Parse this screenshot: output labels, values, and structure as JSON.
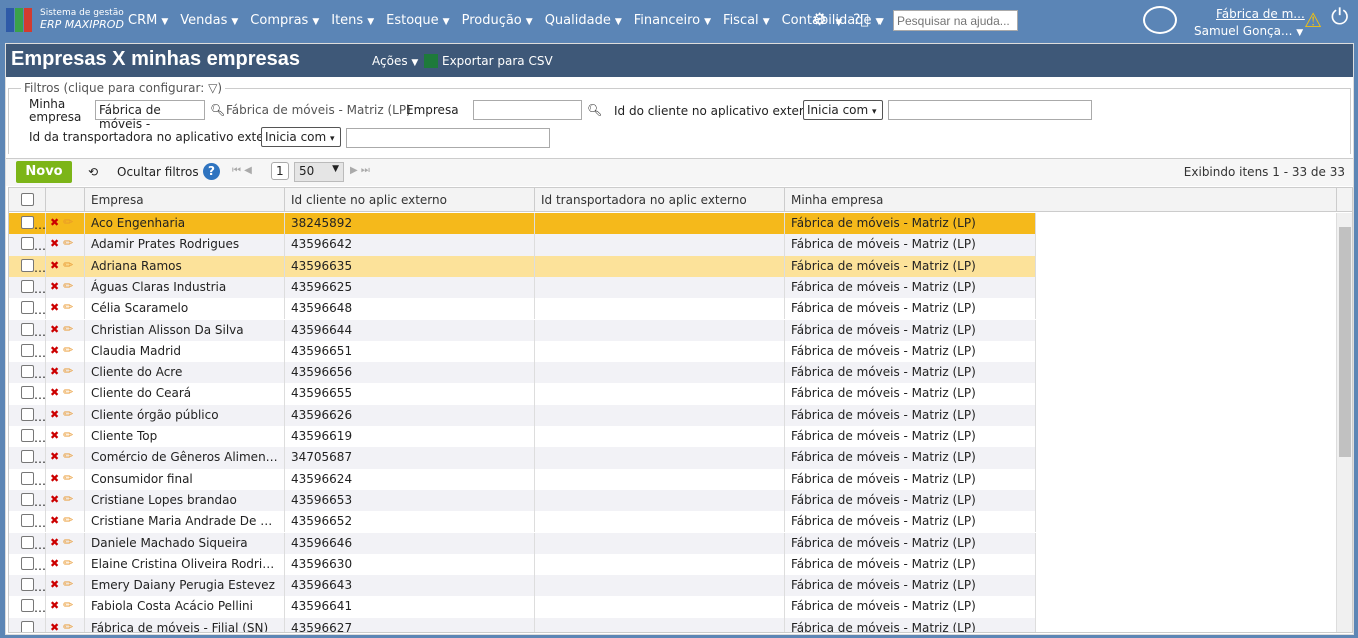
{
  "nav": {
    "brand_top": "Sistema de gestão",
    "brand_bottom": "ERP MAXIPROD",
    "menu": [
      "CRM",
      "Vendas",
      "Compras",
      "Itens",
      "Estoque",
      "Produção",
      "Qualidade",
      "Financeiro",
      "Fiscal",
      "Contabilidade"
    ],
    "help_placeholder": "Pesquisar na ajuda...",
    "company": "Fábrica de m...",
    "user": "Samuel Gonça..."
  },
  "page": {
    "title": "Empresas X minhas empresas",
    "actions": "Ações",
    "export": "Exportar para CSV"
  },
  "filters": {
    "legend": "Filtros (clique para configurar:",
    "minha_empresa_label": "Minha empresa",
    "minha_empresa_value": "Fábrica de móveis -",
    "minha_empresa_desc": "Fábrica de móveis - Matriz (LP)",
    "empresa_label": "Empresa",
    "id_cliente_label": "Id do cliente no aplicativo externo",
    "id_cliente_op": "Inicia com",
    "id_transp_label": "Id da transportadora no aplicativo externo",
    "id_transp_op": "Inicia com"
  },
  "toolbar": {
    "new": "Novo",
    "hide_filters": "Ocultar filtros",
    "page": "1",
    "page_size": "50",
    "showing": "Exibindo itens 1 - 33 de 33"
  },
  "columns": [
    "Empresa",
    "Id cliente no aplic externo",
    "Id transportadora no aplic externo",
    "Minha empresa"
  ],
  "colors": {
    "selected": "#f5b91b",
    "hover": "#fce29a"
  },
  "rows": [
    [
      "Aco Engenharia",
      "38245892",
      "",
      "Fábrica de móveis - Matriz (LP)"
    ],
    [
      "Adamir Prates Rodrigues",
      "43596642",
      "",
      "Fábrica de móveis - Matriz (LP)"
    ],
    [
      "Adriana Ramos",
      "43596635",
      "",
      "Fábrica de móveis - Matriz (LP)"
    ],
    [
      "Águas Claras Industria",
      "43596625",
      "",
      "Fábrica de móveis - Matriz (LP)"
    ],
    [
      "Célia Scaramelo",
      "43596648",
      "",
      "Fábrica de móveis - Matriz (LP)"
    ],
    [
      "Christian Alisson Da Silva",
      "43596644",
      "",
      "Fábrica de móveis - Matriz (LP)"
    ],
    [
      "Claudia Madrid",
      "43596651",
      "",
      "Fábrica de móveis - Matriz (LP)"
    ],
    [
      "Cliente do Acre",
      "43596656",
      "",
      "Fábrica de móveis - Matriz (LP)"
    ],
    [
      "Cliente do Ceará",
      "43596655",
      "",
      "Fábrica de móveis - Matriz (LP)"
    ],
    [
      "Cliente órgão público",
      "43596626",
      "",
      "Fábrica de móveis - Matriz (LP)"
    ],
    [
      "Cliente Top",
      "43596619",
      "",
      "Fábrica de móveis - Matriz (LP)"
    ],
    [
      "Comércio de Gêneros Alimentícios",
      "34705687",
      "",
      "Fábrica de móveis - Matriz (LP)"
    ],
    [
      "Consumidor final",
      "43596624",
      "",
      "Fábrica de móveis - Matriz (LP)"
    ],
    [
      "Cristiane Lopes brandao",
      "43596653",
      "",
      "Fábrica de móveis - Matriz (LP)"
    ],
    [
      "Cristiane Maria Andrade De Santana",
      "43596652",
      "",
      "Fábrica de móveis - Matriz (LP)"
    ],
    [
      "Daniele Machado Siqueira",
      "43596646",
      "",
      "Fábrica de móveis - Matriz (LP)"
    ],
    [
      "Elaine Cristina Oliveira Rodrigues",
      "43596630",
      "",
      "Fábrica de móveis - Matriz (LP)"
    ],
    [
      "Emery Daiany Perugia Estevez",
      "43596643",
      "",
      "Fábrica de móveis - Matriz (LP)"
    ],
    [
      "Fabiola Costa Acácio Pellini",
      "43596641",
      "",
      "Fábrica de móveis - Matriz (LP)"
    ],
    [
      "Fábrica de móveis - Filial (SN)",
      "43596627",
      "",
      "Fábrica de móveis - Matriz (LP)"
    ]
  ]
}
